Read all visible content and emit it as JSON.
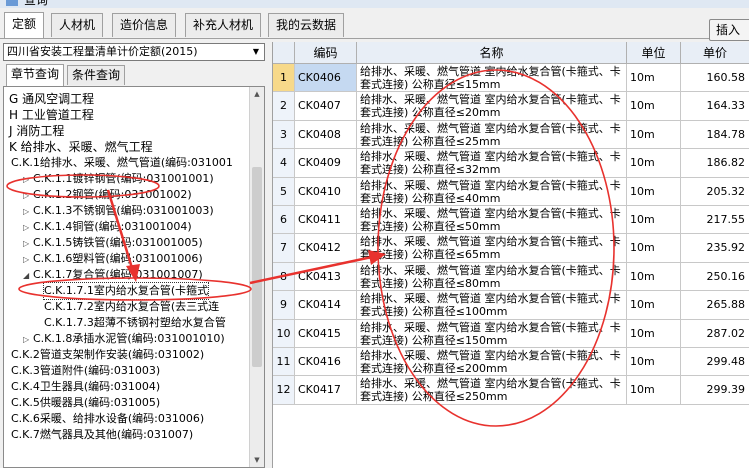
{
  "window": {
    "title": "查询"
  },
  "tabs": [
    "定额",
    "人材机",
    "造价信息",
    "补充人材机",
    "我的云数据"
  ],
  "insert_button": "插入",
  "quota_select": {
    "value": "四川省安装工程量清单计价定额(2015)"
  },
  "left_tabs": [
    "章节查询",
    "条件查询"
  ],
  "tree": [
    {
      "label": "G 通风空调工程",
      "level": 0,
      "expander": ""
    },
    {
      "label": "H 工业管道工程",
      "level": 0,
      "expander": ""
    },
    {
      "label": "J 消防工程",
      "level": 0,
      "expander": ""
    },
    {
      "label": "K 给排水、采暖、燃气工程",
      "level": 0,
      "expander": ""
    },
    {
      "label": "C.K.1给排水、采暖、燃气管道(编码:031001",
      "level": 1,
      "expander": ""
    },
    {
      "label": "C.K.1.1镀锌钢管(编码:031001001)",
      "level": 2,
      "expander": "▷"
    },
    {
      "label": "C.K.1.2钢管(编码:031001002)",
      "level": 2,
      "expander": "▷"
    },
    {
      "label": "C.K.1.3不锈钢管(编码:031001003)",
      "level": 2,
      "expander": "▷"
    },
    {
      "label": "C.K.1.4铜管(编码:031001004)",
      "level": 2,
      "expander": "▷"
    },
    {
      "label": "C.K.1.5铸铁管(编码:031001005)",
      "level": 2,
      "expander": "▷"
    },
    {
      "label": "C.K.1.6塑料管(编码:031001006)",
      "level": 2,
      "expander": "▷"
    },
    {
      "label": "C.K.1.7复合管(编码:031001007)",
      "level": 2,
      "expander": "◢"
    },
    {
      "label": "C.K.1.7.1室内给水复合管(卡箍式",
      "level": 3,
      "expander": ""
    },
    {
      "label": "C.K.1.7.2室内给水复合管(去三式连",
      "level": 3,
      "expander": ""
    },
    {
      "label": "C.K.1.7.3超薄不锈钢衬塑给水复合管",
      "level": 3,
      "expander": ""
    },
    {
      "label": "C.K.1.8承插水泥管(编码:031001010)",
      "level": 2,
      "expander": "▷"
    },
    {
      "label": "C.K.2管道支架制作安装(编码:031002)",
      "level": 1,
      "expander": ""
    },
    {
      "label": "C.K.3管道附件(编码:031003)",
      "level": 1,
      "expander": ""
    },
    {
      "label": "C.K.4卫生器具(编码:031004)",
      "level": 1,
      "expander": ""
    },
    {
      "label": "C.K.5供暖器具(编码:031005)",
      "level": 1,
      "expander": ""
    },
    {
      "label": "C.K.6采暖、给排水设备(编码:031006)",
      "level": 1,
      "expander": ""
    },
    {
      "label": "C.K.7燃气器具及其他(编码:031007)",
      "level": 1,
      "expander": ""
    }
  ],
  "table": {
    "headers": [
      "编码",
      "名称",
      "单位",
      "单价"
    ],
    "rows": [
      {
        "no": "1",
        "code": "CK0406",
        "name": "给排水、采暖、燃气管道 室内给水复合管(卡箍式、卡套式连接) 公称直径≤15mm",
        "unit": "10m",
        "price": "160.58"
      },
      {
        "no": "2",
        "code": "CK0407",
        "name": "给排水、采暖、燃气管道 室内给水复合管(卡箍式、卡套式连接) 公称直径≤20mm",
        "unit": "10m",
        "price": "164.33"
      },
      {
        "no": "3",
        "code": "CK0408",
        "name": "给排水、采暖、燃气管道 室内给水复合管(卡箍式、卡套式连接) 公称直径≤25mm",
        "unit": "10m",
        "price": "184.78"
      },
      {
        "no": "4",
        "code": "CK0409",
        "name": "给排水、采暖、燃气管道 室内给水复合管(卡箍式、卡套式连接) 公称直径≤32mm",
        "unit": "10m",
        "price": "186.82"
      },
      {
        "no": "5",
        "code": "CK0410",
        "name": "给排水、采暖、燃气管道 室内给水复合管(卡箍式、卡套式连接) 公称直径≤40mm",
        "unit": "10m",
        "price": "205.32"
      },
      {
        "no": "6",
        "code": "CK0411",
        "name": "给排水、采暖、燃气管道 室内给水复合管(卡箍式、卡套式连接) 公称直径≤50mm",
        "unit": "10m",
        "price": "217.55"
      },
      {
        "no": "7",
        "code": "CK0412",
        "name": "给排水、采暖、燃气管道 室内给水复合管(卡箍式、卡套式连接) 公称直径≤65mm",
        "unit": "10m",
        "price": "235.92"
      },
      {
        "no": "8",
        "code": "CK0413",
        "name": "给排水、采暖、燃气管道 室内给水复合管(卡箍式、卡套式连接) 公称直径≤80mm",
        "unit": "10m",
        "price": "250.16"
      },
      {
        "no": "9",
        "code": "CK0414",
        "name": "给排水、采暖、燃气管道 室内给水复合管(卡箍式、卡套式连接) 公称直径≤100mm",
        "unit": "10m",
        "price": "265.88"
      },
      {
        "no": "10",
        "code": "CK0415",
        "name": "给排水、采暖、燃气管道 室内给水复合管(卡箍式、卡套式连接) 公称直径≤150mm",
        "unit": "10m",
        "price": "287.02"
      },
      {
        "no": "11",
        "code": "CK0416",
        "name": "给排水、采暖、燃气管道 室内给水复合管(卡箍式、卡套式连接) 公称直径≤200mm",
        "unit": "10m",
        "price": "299.48"
      },
      {
        "no": "12",
        "code": "CK0417",
        "name": "给排水、采暖、燃气管道 室内给水复合管(卡箍式、卡套式连接) 公称直径≤250mm",
        "unit": "10m",
        "price": "299.39"
      }
    ]
  },
  "colors": {
    "annotation": "#e8322e",
    "header_bg": "#e8eef6",
    "selected_row_no": "#f7d98a",
    "selected_code": "#c5d9f1"
  }
}
